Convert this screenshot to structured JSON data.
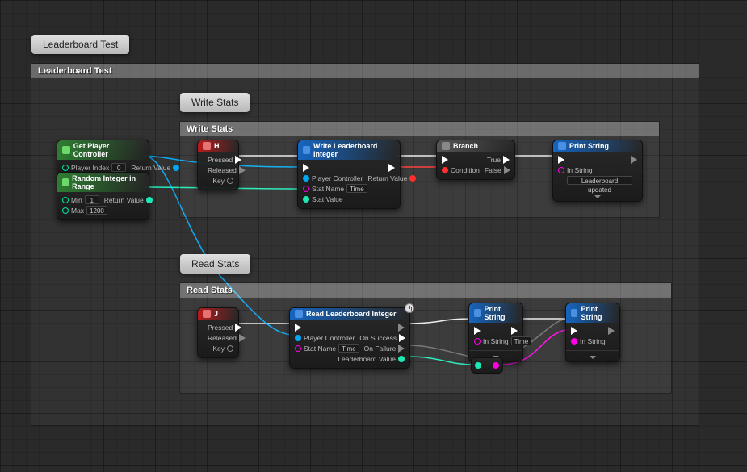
{
  "outerComment": {
    "tab": "Leaderboard Test",
    "header": "Leaderboard Test"
  },
  "writeComment": {
    "tab": "Write Stats",
    "header": "Write Stats"
  },
  "readComment": {
    "tab": "Read Stats",
    "header": "Read Stats"
  },
  "getPlayerController": {
    "title": "Get Player Controller",
    "in_playerIndex": "Player Index",
    "playerIndex_val": "0",
    "out_returnValue": "Return Value"
  },
  "randInt": {
    "title": "Random Integer in Range",
    "in_min": "Min",
    "min_val": "1",
    "in_max": "Max",
    "max_val": "1200",
    "out_returnValue": "Return Value"
  },
  "keyH": {
    "title": "H",
    "out_pressed": "Pressed",
    "out_released": "Released",
    "in_key": "Key"
  },
  "keyJ": {
    "title": "J",
    "out_pressed": "Pressed",
    "out_released": "Released",
    "in_key": "Key"
  },
  "writeLB": {
    "title": "Write Leaderboard Integer",
    "in_playerController": "Player Controller",
    "in_statName": "Stat Name",
    "statName_val": "Time",
    "in_statValue": "Stat Value",
    "out_returnValue": "Return Value"
  },
  "branch": {
    "title": "Branch",
    "in_condition": "Condition",
    "out_true": "True",
    "out_false": "False"
  },
  "printUpdated": {
    "title": "Print String",
    "in_string": "In String",
    "string_val": "Leaderboard updated"
  },
  "readLB": {
    "title": "Read Leaderboard Integer",
    "in_playerController": "Player Controller",
    "in_statName": "Stat Name",
    "statName_val": "Time",
    "out_onSuccess": "On Success",
    "out_onFailure": "On Failure",
    "out_leaderboardValue": "Leaderboard Value"
  },
  "printTime": {
    "title": "Print String",
    "in_string": "In String",
    "string_val": "Time"
  },
  "printPink": {
    "title": "Print String",
    "in_string": "In String"
  }
}
